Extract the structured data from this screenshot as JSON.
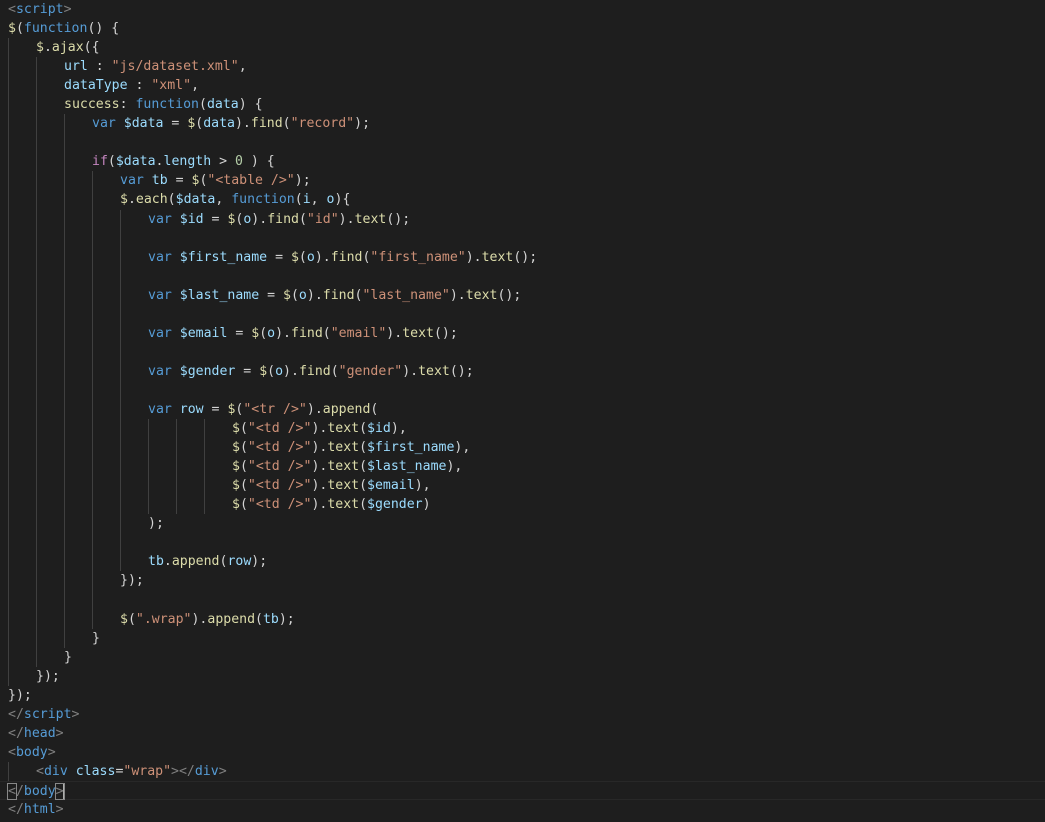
{
  "editor": {
    "colors": {
      "background": "#1e1e1e",
      "tag_punc": "#808080",
      "tag_name": "#569cd6",
      "attribute": "#9cdcfe",
      "keyword": "#569cd6",
      "control": "#c586c0",
      "function": "#dcdcaa",
      "variable": "#9cdcfe",
      "string": "#ce9178",
      "number": "#b5cea8",
      "text": "#d4d4d4",
      "indent_guide": "#404040",
      "cursor": "#aeafad"
    },
    "lines": [
      {
        "indent": 0,
        "tokens": [
          [
            "tag",
            "<"
          ],
          [
            "tagname",
            "script"
          ],
          [
            "tag",
            ">"
          ]
        ]
      },
      {
        "indent": 0,
        "tokens": [
          [
            "jq",
            "$"
          ],
          [
            "punc",
            "("
          ],
          [
            "keyword",
            "function"
          ],
          [
            "punc",
            "() {"
          ]
        ]
      },
      {
        "indent": 1,
        "tokens": [
          [
            "jq",
            "$"
          ],
          [
            "punc",
            "."
          ],
          [
            "func",
            "ajax"
          ],
          [
            "punc",
            "({"
          ]
        ]
      },
      {
        "indent": 2,
        "tokens": [
          [
            "prop",
            "url"
          ],
          [
            "op",
            " : "
          ],
          [
            "string",
            "\"js/dataset.xml\""
          ],
          [
            "punc",
            ","
          ]
        ]
      },
      {
        "indent": 2,
        "tokens": [
          [
            "prop",
            "dataType"
          ],
          [
            "op",
            " : "
          ],
          [
            "string",
            "\"xml\""
          ],
          [
            "punc",
            ","
          ]
        ]
      },
      {
        "indent": 2,
        "tokens": [
          [
            "func",
            "success"
          ],
          [
            "op",
            ": "
          ],
          [
            "keyword",
            "function"
          ],
          [
            "punc",
            "("
          ],
          [
            "var",
            "data"
          ],
          [
            "punc",
            ") {"
          ]
        ]
      },
      {
        "indent": 3,
        "tokens": [
          [
            "keyword",
            "var"
          ],
          [
            "text",
            " "
          ],
          [
            "var",
            "$data"
          ],
          [
            "op",
            " = "
          ],
          [
            "jq",
            "$"
          ],
          [
            "punc",
            "("
          ],
          [
            "var",
            "data"
          ],
          [
            "punc",
            ")."
          ],
          [
            "func",
            "find"
          ],
          [
            "punc",
            "("
          ],
          [
            "string",
            "\"record\""
          ],
          [
            "punc",
            ");"
          ]
        ]
      },
      {
        "indent": 3,
        "tokens": []
      },
      {
        "indent": 3,
        "tokens": [
          [
            "control",
            "if"
          ],
          [
            "punc",
            "("
          ],
          [
            "var",
            "$data"
          ],
          [
            "punc",
            "."
          ],
          [
            "prop",
            "length"
          ],
          [
            "op",
            " > "
          ],
          [
            "number",
            "0"
          ],
          [
            "punc",
            " ) {"
          ]
        ]
      },
      {
        "indent": 4,
        "tokens": [
          [
            "keyword",
            "var"
          ],
          [
            "text",
            " "
          ],
          [
            "var",
            "tb"
          ],
          [
            "op",
            " = "
          ],
          [
            "jq",
            "$"
          ],
          [
            "punc",
            "("
          ],
          [
            "string",
            "\"<table />\""
          ],
          [
            "punc",
            ");"
          ]
        ]
      },
      {
        "indent": 4,
        "tokens": [
          [
            "jq",
            "$"
          ],
          [
            "punc",
            "."
          ],
          [
            "func",
            "each"
          ],
          [
            "punc",
            "("
          ],
          [
            "var",
            "$data"
          ],
          [
            "punc",
            ", "
          ],
          [
            "keyword",
            "function"
          ],
          [
            "punc",
            "("
          ],
          [
            "var",
            "i"
          ],
          [
            "punc",
            ", "
          ],
          [
            "var",
            "o"
          ],
          [
            "punc",
            "){"
          ]
        ]
      },
      {
        "indent": 5,
        "tokens": [
          [
            "keyword",
            "var"
          ],
          [
            "text",
            " "
          ],
          [
            "var",
            "$id"
          ],
          [
            "op",
            " = "
          ],
          [
            "jq",
            "$"
          ],
          [
            "punc",
            "("
          ],
          [
            "var",
            "o"
          ],
          [
            "punc",
            ")."
          ],
          [
            "func",
            "find"
          ],
          [
            "punc",
            "("
          ],
          [
            "string",
            "\"id\""
          ],
          [
            "punc",
            ")."
          ],
          [
            "func",
            "text"
          ],
          [
            "punc",
            "();"
          ]
        ]
      },
      {
        "indent": 5,
        "tokens": []
      },
      {
        "indent": 5,
        "tokens": [
          [
            "keyword",
            "var"
          ],
          [
            "text",
            " "
          ],
          [
            "var",
            "$first_name"
          ],
          [
            "op",
            " = "
          ],
          [
            "jq",
            "$"
          ],
          [
            "punc",
            "("
          ],
          [
            "var",
            "o"
          ],
          [
            "punc",
            ")."
          ],
          [
            "func",
            "find"
          ],
          [
            "punc",
            "("
          ],
          [
            "string",
            "\"first_name\""
          ],
          [
            "punc",
            ")."
          ],
          [
            "func",
            "text"
          ],
          [
            "punc",
            "();"
          ]
        ]
      },
      {
        "indent": 5,
        "tokens": []
      },
      {
        "indent": 5,
        "tokens": [
          [
            "keyword",
            "var"
          ],
          [
            "text",
            " "
          ],
          [
            "var",
            "$last_name"
          ],
          [
            "op",
            " = "
          ],
          [
            "jq",
            "$"
          ],
          [
            "punc",
            "("
          ],
          [
            "var",
            "o"
          ],
          [
            "punc",
            ")."
          ],
          [
            "func",
            "find"
          ],
          [
            "punc",
            "("
          ],
          [
            "string",
            "\"last_name\""
          ],
          [
            "punc",
            ")."
          ],
          [
            "func",
            "text"
          ],
          [
            "punc",
            "();"
          ]
        ]
      },
      {
        "indent": 5,
        "tokens": []
      },
      {
        "indent": 5,
        "tokens": [
          [
            "keyword",
            "var"
          ],
          [
            "text",
            " "
          ],
          [
            "var",
            "$email"
          ],
          [
            "op",
            " = "
          ],
          [
            "jq",
            "$"
          ],
          [
            "punc",
            "("
          ],
          [
            "var",
            "o"
          ],
          [
            "punc",
            ")."
          ],
          [
            "func",
            "find"
          ],
          [
            "punc",
            "("
          ],
          [
            "string",
            "\"email\""
          ],
          [
            "punc",
            ")."
          ],
          [
            "func",
            "text"
          ],
          [
            "punc",
            "();"
          ]
        ]
      },
      {
        "indent": 5,
        "tokens": []
      },
      {
        "indent": 5,
        "tokens": [
          [
            "keyword",
            "var"
          ],
          [
            "text",
            " "
          ],
          [
            "var",
            "$gender"
          ],
          [
            "op",
            " = "
          ],
          [
            "jq",
            "$"
          ],
          [
            "punc",
            "("
          ],
          [
            "var",
            "o"
          ],
          [
            "punc",
            ")."
          ],
          [
            "func",
            "find"
          ],
          [
            "punc",
            "("
          ],
          [
            "string",
            "\"gender\""
          ],
          [
            "punc",
            ")."
          ],
          [
            "func",
            "text"
          ],
          [
            "punc",
            "();"
          ]
        ]
      },
      {
        "indent": 5,
        "tokens": []
      },
      {
        "indent": 5,
        "tokens": [
          [
            "keyword",
            "var"
          ],
          [
            "text",
            " "
          ],
          [
            "var",
            "row"
          ],
          [
            "op",
            " = "
          ],
          [
            "jq",
            "$"
          ],
          [
            "punc",
            "("
          ],
          [
            "string",
            "\"<tr />\""
          ],
          [
            "punc",
            ")."
          ],
          [
            "func",
            "append"
          ],
          [
            "punc",
            "("
          ]
        ]
      },
      {
        "indent": 8,
        "tokens": [
          [
            "jq",
            "$"
          ],
          [
            "punc",
            "("
          ],
          [
            "string",
            "\"<td />\""
          ],
          [
            "punc",
            ")."
          ],
          [
            "func",
            "text"
          ],
          [
            "punc",
            "("
          ],
          [
            "var",
            "$id"
          ],
          [
            "punc",
            "),"
          ]
        ]
      },
      {
        "indent": 8,
        "tokens": [
          [
            "jq",
            "$"
          ],
          [
            "punc",
            "("
          ],
          [
            "string",
            "\"<td />\""
          ],
          [
            "punc",
            ")."
          ],
          [
            "func",
            "text"
          ],
          [
            "punc",
            "("
          ],
          [
            "var",
            "$first_name"
          ],
          [
            "punc",
            "),"
          ]
        ]
      },
      {
        "indent": 8,
        "tokens": [
          [
            "jq",
            "$"
          ],
          [
            "punc",
            "("
          ],
          [
            "string",
            "\"<td />\""
          ],
          [
            "punc",
            ")."
          ],
          [
            "func",
            "text"
          ],
          [
            "punc",
            "("
          ],
          [
            "var",
            "$last_name"
          ],
          [
            "punc",
            "),"
          ]
        ]
      },
      {
        "indent": 8,
        "tokens": [
          [
            "jq",
            "$"
          ],
          [
            "punc",
            "("
          ],
          [
            "string",
            "\"<td />\""
          ],
          [
            "punc",
            ")."
          ],
          [
            "func",
            "text"
          ],
          [
            "punc",
            "("
          ],
          [
            "var",
            "$email"
          ],
          [
            "punc",
            "),"
          ]
        ]
      },
      {
        "indent": 8,
        "tokens": [
          [
            "jq",
            "$"
          ],
          [
            "punc",
            "("
          ],
          [
            "string",
            "\"<td />\""
          ],
          [
            "punc",
            ")."
          ],
          [
            "func",
            "text"
          ],
          [
            "punc",
            "("
          ],
          [
            "var",
            "$gender"
          ],
          [
            "punc",
            ")"
          ]
        ]
      },
      {
        "indent": 5,
        "tokens": [
          [
            "punc",
            ");"
          ]
        ]
      },
      {
        "indent": 5,
        "tokens": []
      },
      {
        "indent": 5,
        "tokens": [
          [
            "var",
            "tb"
          ],
          [
            "punc",
            "."
          ],
          [
            "func",
            "append"
          ],
          [
            "punc",
            "("
          ],
          [
            "var",
            "row"
          ],
          [
            "punc",
            ");"
          ]
        ]
      },
      {
        "indent": 4,
        "tokens": [
          [
            "punc",
            "});"
          ]
        ]
      },
      {
        "indent": 4,
        "tokens": []
      },
      {
        "indent": 4,
        "tokens": [
          [
            "jq",
            "$"
          ],
          [
            "punc",
            "("
          ],
          [
            "string",
            "\".wrap\""
          ],
          [
            "punc",
            ")."
          ],
          [
            "func",
            "append"
          ],
          [
            "punc",
            "("
          ],
          [
            "var",
            "tb"
          ],
          [
            "punc",
            ");"
          ]
        ]
      },
      {
        "indent": 3,
        "tokens": [
          [
            "punc",
            "}"
          ]
        ]
      },
      {
        "indent": 2,
        "tokens": [
          [
            "punc",
            "}"
          ]
        ]
      },
      {
        "indent": 1,
        "tokens": [
          [
            "punc",
            "});"
          ]
        ]
      },
      {
        "indent": 0,
        "tokens": [
          [
            "punc",
            "});"
          ]
        ]
      },
      {
        "indent": 0,
        "tokens": [
          [
            "tag",
            "</"
          ],
          [
            "tagname",
            "script"
          ],
          [
            "tag",
            ">"
          ]
        ]
      },
      {
        "indent": 0,
        "tokens": [
          [
            "tag",
            "</"
          ],
          [
            "tagname",
            "head"
          ],
          [
            "tag",
            ">"
          ]
        ]
      },
      {
        "indent": 0,
        "tokens": [
          [
            "tag",
            "<"
          ],
          [
            "tagname",
            "body"
          ],
          [
            "tag",
            ">"
          ]
        ]
      },
      {
        "indent": 1,
        "tokens": [
          [
            "tag",
            "<"
          ],
          [
            "tagname",
            "div"
          ],
          [
            "text",
            " "
          ],
          [
            "attr",
            "class"
          ],
          [
            "punc",
            "="
          ],
          [
            "string",
            "\"wrap\""
          ],
          [
            "tag",
            "></"
          ],
          [
            "tagname",
            "div"
          ],
          [
            "tag",
            ">"
          ]
        ]
      },
      {
        "indent": 0,
        "current": true,
        "tokens": [
          [
            "bracket",
            "<"
          ],
          [
            "tag",
            "/"
          ],
          [
            "tagname",
            "body"
          ],
          [
            "bracket",
            ">"
          ],
          [
            "cursor",
            ""
          ]
        ]
      },
      {
        "indent": 0,
        "tokens": [
          [
            "tag",
            "</"
          ],
          [
            "tagname",
            "html"
          ],
          [
            "tag",
            ">"
          ]
        ]
      }
    ]
  }
}
